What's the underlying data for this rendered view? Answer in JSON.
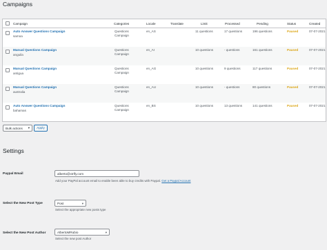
{
  "page": {
    "title": "Campaigns"
  },
  "table": {
    "headers": {
      "campaign": "Campaign",
      "categories": "Categories",
      "locale": "Locale",
      "translate": "Translate",
      "limit": "Limit",
      "processed": "Processed",
      "pending": "Pending",
      "status": "Status",
      "created": "Created"
    },
    "rows": [
      {
        "name": "Auto Answer Questions Campaign",
        "sub": "samoa",
        "cat1": "Questions",
        "cat2": "Campaign",
        "locale": "en_AS",
        "limit": "11 questions",
        "processed": "17 questions",
        "pending": "196 questions",
        "status": "Paused",
        "created": "07-07-2021"
      },
      {
        "name": "Manual Questions Campaign",
        "sub": "anguila",
        "cat1": "Questions",
        "cat2": "Campaign",
        "locale": "en_AI",
        "limit": "10 questions",
        "processed": "- questions",
        "pending": "161 questions",
        "status": "Paused",
        "created": "07-07-2021"
      },
      {
        "name": "Manual Questions Campaign",
        "sub": "antigua",
        "cat1": "Questions",
        "cat2": "Campaign",
        "locale": "en_AG",
        "limit": "10 questions",
        "processed": "9 questions",
        "pending": "117 questions",
        "status": "Paused",
        "created": "07-07-2021"
      },
      {
        "name": "Manual Questions Campaign",
        "sub": "australia",
        "cat1": "Questions",
        "cat2": "Campaign",
        "locale": "en_AU",
        "limit": "10 questions",
        "processed": "- questions",
        "pending": "80 questions",
        "status": "Paused",
        "created": "07-07-2021"
      },
      {
        "name": "Auto Answer Questions Campaign",
        "sub": "bahamas",
        "cat1": "Questions",
        "cat2": "Campaign",
        "locale": "en_BS",
        "limit": "10 questions",
        "processed": "13 questions",
        "pending": "141 questions",
        "status": "Paused",
        "created": "07-07-2021"
      }
    ]
  },
  "bulk": {
    "select_label": "Bulk actions",
    "apply_label": "Apply"
  },
  "settings": {
    "title": "Settings",
    "paypal": {
      "label": "Paypal Email",
      "value": "alberto@ctrlfy.com",
      "desc": "Add your PayPal account email to enable been able to buy credits with Paypal.",
      "link": "Get a Paypal Account"
    },
    "post_type": {
      "label": "Select the New Post Type",
      "value": "Post",
      "desc": "Select the appropriate new posts type"
    },
    "post_author": {
      "label": "Select the New Post Author",
      "value": "AlbertoMRubio",
      "desc": "Select the new post Author"
    }
  },
  "colors": {
    "link": "#2271b1",
    "paused": "#dba617"
  },
  "icons": {
    "checkbox": "checkbox-icon",
    "dropdown": "chevron-down-icon"
  }
}
